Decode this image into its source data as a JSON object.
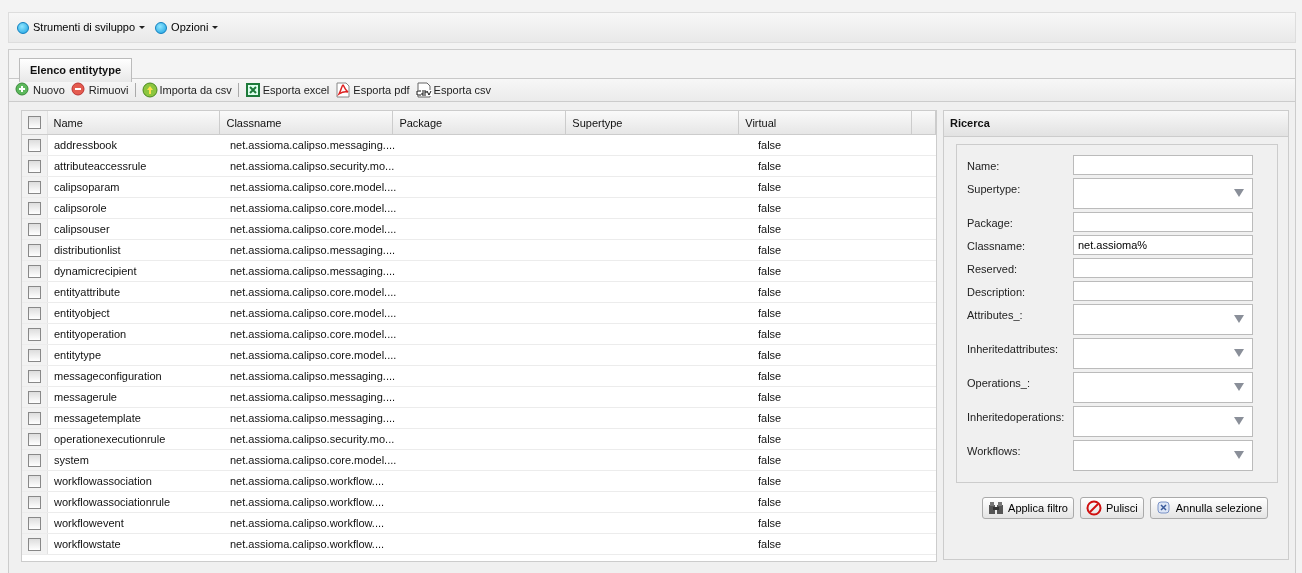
{
  "menu": [
    {
      "label": "Strumenti di sviluppo"
    },
    {
      "label": "Opzioni"
    }
  ],
  "tabs": [
    {
      "label": "Elenco entitytype",
      "selected": true
    }
  ],
  "toolbar": [
    {
      "kind": "add",
      "label": "Nuovo"
    },
    {
      "kind": "remove",
      "label": "Rimuovi"
    },
    {
      "kind": "sep"
    },
    {
      "kind": "import",
      "label": "Importa da csv"
    },
    {
      "kind": "sep"
    },
    {
      "kind": "excel",
      "label": "Esporta excel"
    },
    {
      "kind": "pdf",
      "label": "Esporta pdf"
    },
    {
      "kind": "csv",
      "label": "Esporta csv"
    }
  ],
  "table": {
    "select_all": {
      "checked": false
    },
    "columns": [
      "Name",
      "Classname",
      "Package",
      "Supertype",
      "Virtual"
    ],
    "rows": [
      {
        "checked": false,
        "cells": [
          "addressbook",
          "net.assioma.calipso.messaging....",
          "",
          "",
          "false"
        ]
      },
      {
        "checked": false,
        "cells": [
          "attributeaccessrule",
          "net.assioma.calipso.security.mo...",
          "",
          "",
          "false"
        ]
      },
      {
        "checked": false,
        "cells": [
          "calipsoparam",
          "net.assioma.calipso.core.model....",
          "",
          "",
          "false"
        ]
      },
      {
        "checked": false,
        "cells": [
          "calipsorole",
          "net.assioma.calipso.core.model....",
          "",
          "",
          "false"
        ]
      },
      {
        "checked": false,
        "cells": [
          "calipsouser",
          "net.assioma.calipso.core.model....",
          "",
          "",
          "false"
        ]
      },
      {
        "checked": false,
        "cells": [
          "distributionlist",
          "net.assioma.calipso.messaging....",
          "",
          "",
          "false"
        ]
      },
      {
        "checked": false,
        "cells": [
          "dynamicrecipient",
          "net.assioma.calipso.messaging....",
          "",
          "",
          "false"
        ]
      },
      {
        "checked": false,
        "cells": [
          "entityattribute",
          "net.assioma.calipso.core.model....",
          "",
          "",
          "false"
        ]
      },
      {
        "checked": false,
        "cells": [
          "entityobject",
          "net.assioma.calipso.core.model....",
          "",
          "",
          "false"
        ]
      },
      {
        "checked": false,
        "cells": [
          "entityoperation",
          "net.assioma.calipso.core.model....",
          "",
          "",
          "false"
        ]
      },
      {
        "checked": false,
        "cells": [
          "entitytype",
          "net.assioma.calipso.core.model....",
          "",
          "",
          "false"
        ]
      },
      {
        "checked": false,
        "cells": [
          "messageconfiguration",
          "net.assioma.calipso.messaging....",
          "",
          "",
          "false"
        ]
      },
      {
        "checked": false,
        "cells": [
          "messagerule",
          "net.assioma.calipso.messaging....",
          "",
          "",
          "false"
        ]
      },
      {
        "checked": false,
        "cells": [
          "messagetemplate",
          "net.assioma.calipso.messaging....",
          "",
          "",
          "false"
        ]
      },
      {
        "checked": false,
        "cells": [
          "operationexecutionrule",
          "net.assioma.calipso.security.mo...",
          "",
          "",
          "false"
        ]
      },
      {
        "checked": false,
        "cells": [
          "system",
          "net.assioma.calipso.core.model....",
          "",
          "",
          "false"
        ]
      },
      {
        "checked": false,
        "cells": [
          "workflowassociation",
          "net.assioma.calipso.workflow....",
          "",
          "",
          "false"
        ]
      },
      {
        "checked": false,
        "cells": [
          "workflowassociationrule",
          "net.assioma.calipso.workflow....",
          "",
          "",
          "false"
        ]
      },
      {
        "checked": false,
        "cells": [
          "workflowevent",
          "net.assioma.calipso.workflow....",
          "",
          "",
          "false"
        ]
      },
      {
        "checked": false,
        "cells": [
          "workflowstate",
          "net.assioma.calipso.workflow....",
          "",
          "",
          "false"
        ]
      }
    ]
  },
  "search": {
    "title": "Ricerca",
    "fields": [
      {
        "kind": "text",
        "label": "Name:"
      },
      {
        "kind": "select",
        "label": "Supertype:"
      },
      {
        "kind": "text",
        "label": "Package:"
      },
      {
        "kind": "text",
        "label": "Classname:",
        "value": "net.assioma%"
      },
      {
        "kind": "text",
        "label": "Reserved:"
      },
      {
        "kind": "text",
        "label": "Description:"
      },
      {
        "kind": "select",
        "label": "Attributes_:"
      },
      {
        "kind": "select",
        "label": "Inheritedattributes:"
      },
      {
        "kind": "select",
        "label": "Operations_:"
      },
      {
        "kind": "select",
        "label": "Inheritedoperations:"
      },
      {
        "kind": "select",
        "label": "Workflows:"
      }
    ],
    "buttons": [
      {
        "kind": "apply",
        "label": "Applica filtro"
      },
      {
        "kind": "clear",
        "label": "Pulisci"
      },
      {
        "kind": "cancel",
        "label": "Annulla selezione"
      }
    ]
  }
}
